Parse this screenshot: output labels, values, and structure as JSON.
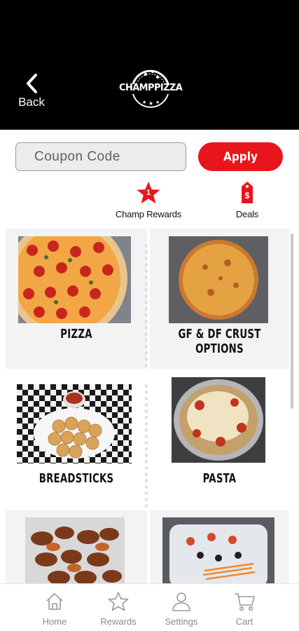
{
  "header": {
    "back_label": "Back",
    "logo_text": "CHAMPPIZZA"
  },
  "coupon": {
    "placeholder": "Coupon Code",
    "apply_label": "Apply"
  },
  "quick_links": [
    {
      "label": "Champ Rewards",
      "icon": "star-icon",
      "badge": "1"
    },
    {
      "label": "Deals",
      "icon": "price-tag-icon",
      "badge": "$"
    }
  ],
  "categories": [
    {
      "label": "PIZZA",
      "image": "pepperoni-pizza"
    },
    {
      "label": "GF & DF CRUST OPTIONS",
      "image": "cheese-pizza"
    },
    {
      "label": "BREADSTICKS",
      "image": "breadsticks-basket"
    },
    {
      "label": "PASTA",
      "image": "baked-pasta-tray"
    },
    {
      "label": "",
      "image": "chicken-wings"
    },
    {
      "label": "",
      "image": "salad-tray"
    }
  ],
  "bottom_nav": [
    {
      "label": "Home",
      "icon": "home-icon"
    },
    {
      "label": "Rewards",
      "icon": "star-outline-icon"
    },
    {
      "label": "Settings",
      "icon": "user-icon"
    },
    {
      "label": "Cart",
      "icon": "cart-icon"
    }
  ],
  "colors": {
    "accent": "#e8151c",
    "header_bg": "#000000",
    "nav_text": "#8a8a8a"
  }
}
